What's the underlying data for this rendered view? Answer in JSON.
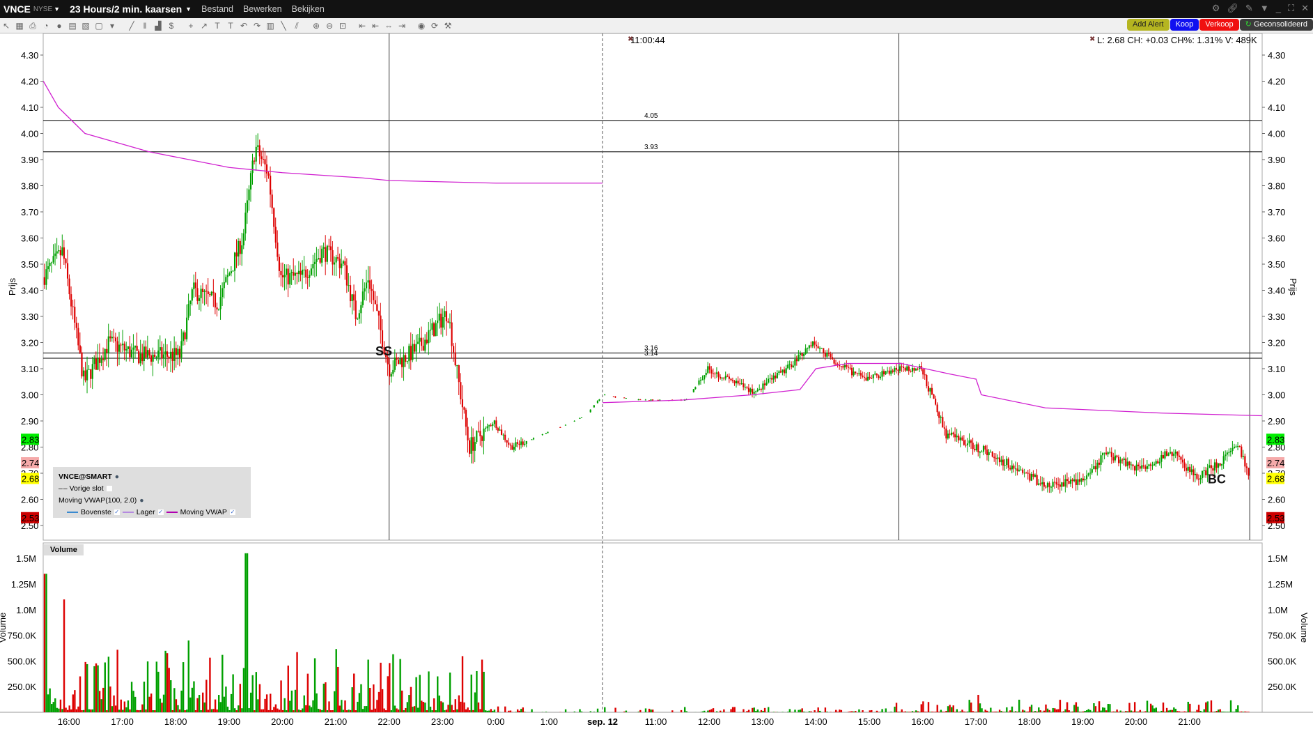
{
  "titlebar": {
    "symbol": "VNCE",
    "exchange": "NYSE",
    "timeframe": "23 Hours/2 min. kaarsen",
    "menus": [
      "Bestand",
      "Bewerken",
      "Bekijken"
    ],
    "window_controls": [
      "gear-icon",
      "link-icon",
      "pin-icon",
      "dropdown-icon",
      "minimize-icon",
      "maximize-icon",
      "close-icon"
    ]
  },
  "toolbar": {
    "icons": [
      "cursor-icon",
      "grid-icon",
      "print-icon",
      "clock-icon",
      "circle-icon",
      "layout-icon",
      "chart-settings-icon",
      "blank-icon",
      "dropdown-icon",
      "pencil-icon",
      "bars-icon",
      "volume-icon",
      "dollar-icon",
      "crosshair-icon",
      "arrow-icon",
      "text-icon",
      "text-note-icon",
      "undo-icon",
      "redo-icon",
      "layers-icon",
      "trendline-icon",
      "channel-icon",
      "zoom-in-icon",
      "zoom-out-icon",
      "fit-icon",
      "scroll-left-icon",
      "scroll-left2-icon",
      "scroll-both-icon",
      "scroll-right-icon",
      "globe-icon",
      "refresh-icon",
      "wrench-icon"
    ]
  },
  "order_buttons": {
    "add_alert": "Add Alert",
    "buy": "Koop",
    "sell": "Verkoop",
    "consolidated": "Geconsolideerd"
  },
  "info": {
    "cursor_time": "11:00:44",
    "quote": "L: 2.68 CH: +0.03 CH%: 1.31% V: 489K"
  },
  "legend": {
    "title": "VNCE@SMART",
    "prev_close": "Vorige slot",
    "indicator": "Moving VWAP(100, 2.0)",
    "series": [
      {
        "name": "Bovenste",
        "color": "#3a8ad0"
      },
      {
        "name": "Lager",
        "color": "#b58ae0"
      },
      {
        "name": "Moving VWAP",
        "color": "#b000b0"
      }
    ]
  },
  "volume_title": "Volume",
  "price_badges": [
    {
      "value": "2.83",
      "bg": "#00ee00"
    },
    {
      "value": "2.74",
      "bg": "#f5aaaa"
    },
    {
      "value": "2.68",
      "bg": "#ffff00"
    },
    {
      "value": "2.53",
      "bg": "#cc0000"
    }
  ],
  "chart_data": {
    "type": "candlestick",
    "ylabel": "Prijs",
    "vol_label": "Volume",
    "ylim": [
      2.45,
      4.35
    ],
    "yticks": [
      "4.30",
      "4.20",
      "4.10",
      "4.00",
      "3.90",
      "3.80",
      "3.70",
      "3.60",
      "3.50",
      "3.40",
      "3.30",
      "3.20",
      "3.10",
      "3.00",
      "2.90",
      "2.80",
      "2.70",
      "2.60",
      "2.50"
    ],
    "vol_ticks": [
      {
        "v": 1500000,
        "label": "1.5M"
      },
      {
        "v": 1250000,
        "label": "1.25M"
      },
      {
        "v": 1000000,
        "label": "1.0M"
      },
      {
        "v": 750000,
        "label": "750.0K"
      },
      {
        "v": 500000,
        "label": "500.0K"
      },
      {
        "v": 250000,
        "label": "250.0K"
      }
    ],
    "xticks": [
      "16:00",
      "17:00",
      "18:00",
      "19:00",
      "20:00",
      "21:00",
      "22:00",
      "23:00",
      "0:00",
      "1:00",
      "sep. 12",
      "11:00",
      "12:00",
      "13:00",
      "14:00",
      "15:00",
      "16:00",
      "17:00",
      "18:00",
      "19:00",
      "20:00",
      "21:00"
    ],
    "hlines": [
      {
        "value": 4.05,
        "label": "4.05"
      },
      {
        "value": 3.93,
        "label": "3.93"
      },
      {
        "value": 3.16,
        "label": "3.16"
      },
      {
        "value": 3.14,
        "label": "3.14"
      }
    ],
    "vlines_h": [
      6.0,
      15.55,
      22.13
    ],
    "date_break_h": 10.0,
    "annotations": [
      {
        "text": "SS",
        "h": 5.9,
        "price": 3.17
      },
      {
        "text": "BC",
        "h": 21.5,
        "price": 2.68
      }
    ],
    "price_path": [
      [
        -0.48,
        3.45
      ],
      [
        -0.12,
        3.55
      ],
      [
        0.28,
        3.05
      ],
      [
        0.75,
        3.2
      ],
      [
        1.3,
        3.15
      ],
      [
        2.08,
        3.15
      ],
      [
        2.32,
        3.4
      ],
      [
        2.79,
        3.35
      ],
      [
        3.26,
        3.6
      ],
      [
        3.49,
        3.95
      ],
      [
        3.73,
        3.85
      ],
      [
        3.97,
        3.45
      ],
      [
        4.36,
        3.45
      ],
      [
        4.75,
        3.55
      ],
      [
        5.14,
        3.5
      ],
      [
        5.38,
        3.3
      ],
      [
        5.61,
        3.45
      ],
      [
        6.0,
        3.1
      ],
      [
        6.55,
        3.18
      ],
      [
        7.1,
        3.32
      ],
      [
        7.26,
        3.1
      ],
      [
        7.5,
        2.8
      ],
      [
        7.96,
        2.9
      ],
      [
        8.28,
        2.8
      ],
      [
        8.9,
        2.85
      ],
      [
        9.69,
        2.92
      ],
      [
        10.0,
        3.0
      ],
      [
        10.63,
        2.98
      ],
      [
        11.57,
        2.98
      ],
      [
        11.97,
        3.1
      ],
      [
        12.83,
        3.01
      ],
      [
        13.46,
        3.1
      ],
      [
        13.93,
        3.2
      ],
      [
        14.4,
        3.12
      ],
      [
        14.9,
        3.06
      ],
      [
        15.58,
        3.1
      ],
      [
        15.97,
        3.1
      ],
      [
        16.44,
        2.85
      ],
      [
        17.22,
        2.78
      ],
      [
        18.33,
        2.65
      ],
      [
        19.1,
        2.68
      ],
      [
        19.42,
        2.78
      ],
      [
        20.05,
        2.72
      ],
      [
        20.68,
        2.78
      ],
      [
        21.15,
        2.68
      ],
      [
        21.93,
        2.8
      ],
      [
        22.12,
        2.68
      ]
    ],
    "vwap_1": [
      [
        -0.48,
        4.2
      ],
      [
        -0.2,
        4.1
      ],
      [
        0.3,
        4.0
      ],
      [
        1.5,
        3.93
      ],
      [
        3.0,
        3.87
      ],
      [
        4.0,
        3.85
      ],
      [
        5.5,
        3.83
      ],
      [
        6.0,
        3.82
      ],
      [
        8.0,
        3.81
      ],
      [
        10.0,
        3.81
      ]
    ],
    "vwap_2": [
      [
        10.0,
        2.97
      ],
      [
        11.5,
        2.98
      ],
      [
        12.8,
        3.0
      ],
      [
        13.7,
        3.02
      ],
      [
        14.0,
        3.1
      ],
      [
        14.6,
        3.12
      ],
      [
        15.6,
        3.12
      ],
      [
        16.5,
        3.08
      ],
      [
        17.0,
        3.06
      ],
      [
        17.1,
        3.0
      ],
      [
        18.3,
        2.95
      ],
      [
        20.5,
        2.93
      ],
      [
        22.36,
        2.92
      ]
    ]
  }
}
